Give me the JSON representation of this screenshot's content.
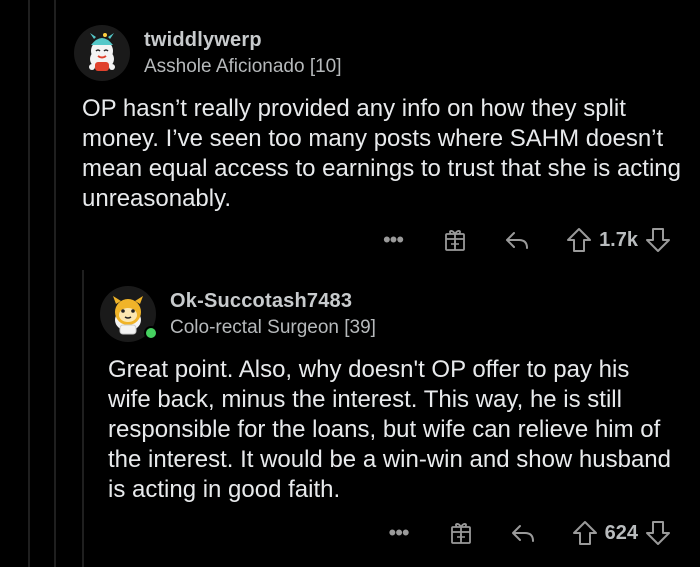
{
  "comments": [
    {
      "username": "twiddlywerp",
      "flair": "Asshole Aficionado [10]",
      "body": "OP hasn’t really provided any info on how they split money. I’ve seen too many posts where SAHM doesn’t mean equal access to earnings to trust that she is acting unreasonably.",
      "score": "1.7k",
      "online": false
    },
    {
      "username": "Ok-Succotash7483",
      "flair": "Colo-rectal Surgeon [39]",
      "body": "Great point. Also, why doesn't OP offer to pay his wife back, minus the interest. This way, he is still responsible for the loans, but wife can relieve him of the interest. It would be a win-win and show husband is acting in good faith.",
      "score": "624",
      "online": true
    }
  ],
  "actions": {
    "more_label": "•••"
  },
  "colors": {
    "background": "#000000",
    "text": "#e8eaec",
    "muted": "#b6b9bb",
    "online": "#46d160"
  },
  "icons": [
    "more-icon",
    "award-icon",
    "reply-icon",
    "upvote-icon",
    "downvote-icon"
  ]
}
